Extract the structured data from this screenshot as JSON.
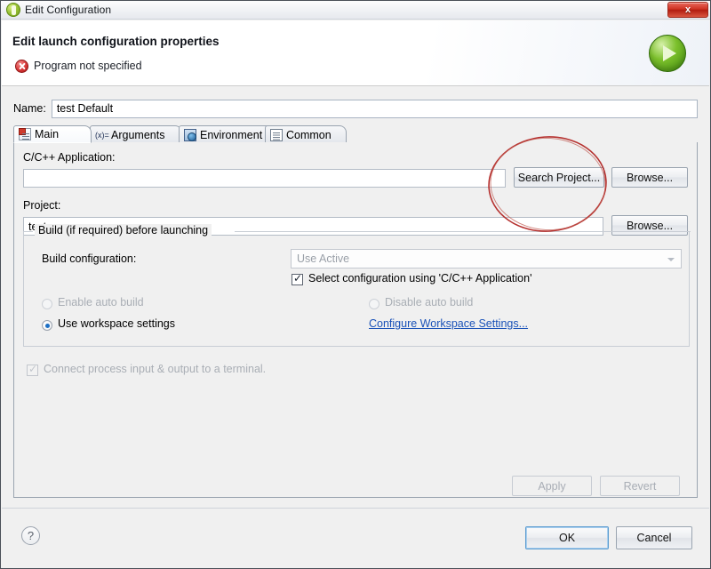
{
  "window": {
    "title": "Edit Configuration",
    "title_icon": "eclipse-launch-icon",
    "close_label": "x"
  },
  "banner": {
    "heading": "Edit launch configuration properties",
    "error_message": "Program not specified",
    "error_icon": "error-circle-icon",
    "run_icon": "run-play-icon"
  },
  "name_row": {
    "label": "Name:",
    "value": "test Default",
    "placeholder": ""
  },
  "tabs": [
    {
      "label": "Main",
      "icon": "main-document-icon",
      "selected": true
    },
    {
      "label": "Arguments",
      "icon": "arguments-variable-icon",
      "selected": false
    },
    {
      "label": "Environment",
      "icon": "environment-icon",
      "selected": false
    },
    {
      "label": "Common",
      "icon": "common-list-icon",
      "selected": false
    }
  ],
  "main_tab": {
    "application_label": "C/C++ Application:",
    "application_value": "",
    "search_project_button": "Search Project...",
    "application_browse_button": "Browse...",
    "project_label": "Project:",
    "project_value": "test",
    "project_browse_button": "Browse...",
    "build_group_title": "Build (if required) before launching",
    "build_config_label": "Build configuration:",
    "build_config_value": "Use Active",
    "build_config_options": [
      "Use Active"
    ],
    "select_config_checkbox": "Select configuration using 'C/C++ Application'",
    "select_config_checked": true,
    "enable_auto_build": "Enable auto build",
    "disable_auto_build": "Disable auto build",
    "use_workspace_settings": "Use workspace settings",
    "use_workspace_selected": true,
    "configure_workspace_link": "Configure Workspace Settings...",
    "connect_terminal_checkbox": "Connect process input & output to a terminal.",
    "connect_terminal_checked": true,
    "connect_terminal_disabled": true
  },
  "buttons": {
    "apply": "Apply",
    "revert": "Revert",
    "ok": "OK",
    "cancel": "Cancel",
    "help": "?"
  },
  "annotation": {
    "shape": "ellipse",
    "color": "#b5302e",
    "target": "Search Project..."
  },
  "colors": {
    "accent_blue": "#1c6fc4",
    "link_blue": "#1a52b8",
    "error_red": "#d93a3a",
    "close_red": "#cf3222",
    "run_green": "#7cc02c",
    "annotation_red": "#b5302e",
    "window_bg": "#f0f0f0"
  }
}
